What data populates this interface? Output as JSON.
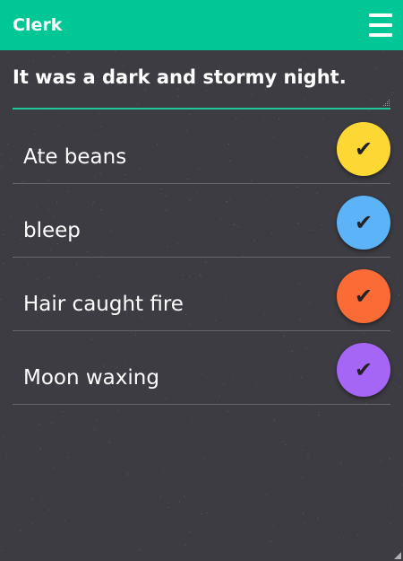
{
  "header": {
    "app_title": "Clerk",
    "menu_icon": "hamburger-menu-icon",
    "background": "#00c795"
  },
  "note": {
    "title": "It was a dark and stormy night.",
    "underline_color": "#1fc79a"
  },
  "items": [
    {
      "label": "Ate beans",
      "color": "#fdd835",
      "icon": "checkmark-icon",
      "glyph": "✔"
    },
    {
      "label": "bleep",
      "color": "#5db3f8",
      "icon": "checkmark-icon",
      "glyph": "✔"
    },
    {
      "label": "Hair caught fire",
      "color": "#fb6b35",
      "icon": "checkmark-icon",
      "glyph": "✔"
    },
    {
      "label": "Moon waxing",
      "color": "#a566f5",
      "icon": "checkmark-icon",
      "glyph": "✔"
    }
  ],
  "colors": {
    "background": "#3d3c42",
    "divider": "#66656c"
  }
}
